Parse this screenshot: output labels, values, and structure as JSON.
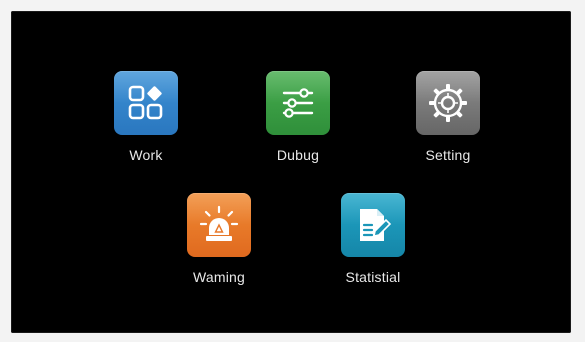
{
  "apps": [
    {
      "id": "work",
      "label": "Work",
      "icon": "grid-apps-icon",
      "color": "#2f80c8"
    },
    {
      "id": "debug",
      "label": "Dubug",
      "icon": "sliders-icon",
      "color": "#3a9c45"
    },
    {
      "id": "setting",
      "label": "Setting",
      "icon": "gear-icon",
      "color": "#7a7a7a"
    },
    {
      "id": "warning",
      "label": "Waming",
      "icon": "alarm-light-icon",
      "color": "#e8782a"
    },
    {
      "id": "statistial",
      "label": "Statistial",
      "icon": "document-edit-icon",
      "color": "#1a96b8"
    }
  ]
}
